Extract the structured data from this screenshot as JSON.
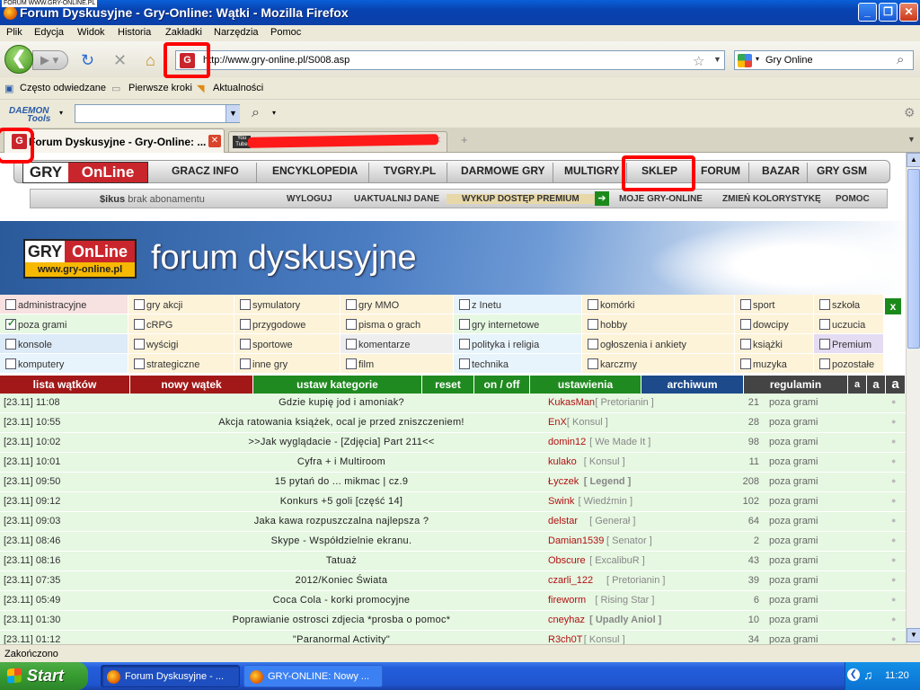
{
  "window": {
    "tiny_label": "FORUM WWW.GRY-ONLINE.PL",
    "title": "Forum Dyskusyjne - Gry-Online: Wątki - Mozilla Firefox"
  },
  "menu": [
    "Plik",
    "Edycja",
    "Widok",
    "Historia",
    "Zakładki",
    "Narzędzia",
    "Pomoc"
  ],
  "url": "http://www.gry-online.pl/S008.asp",
  "search_engine": "Gry Online",
  "bookmarks": [
    "Często odwiedzane",
    "Pierwsze kroki",
    "Aktualności"
  ],
  "daemon": {
    "line1": "DAEMON",
    "line2": "Tools"
  },
  "tabs": [
    {
      "label": "Forum Dyskusyjne - Gry-Online: ..."
    },
    {
      "label": ""
    }
  ],
  "site_nav": {
    "logo_left": "GRY",
    "logo_right": "OnLine",
    "items": [
      "GRACZ INFO",
      "ENCYKLOPEDIA",
      "TVGRY.PL",
      "DARMOWE GRY",
      "MULTIGRY",
      "SKLEP",
      "FORUM",
      "BAZAR",
      "GRY GSM"
    ]
  },
  "sub_nav": {
    "user": "$ikus",
    "user_status": "brak abonamentu",
    "items": [
      "WYLOGUJ",
      "UAKTUALNIJ DANE",
      "WYKUP DOSTĘP PREMIUM",
      "MOJE GRY-ONLINE",
      "ZMIEŃ KOLORYSTYKĘ",
      "POMOC"
    ]
  },
  "banner": {
    "logo_left": "GRY",
    "logo_right": "OnLine",
    "logo_url": "www.gry-online.pl",
    "title": "forum dyskusyjne"
  },
  "categories": [
    [
      "administracyjne",
      "gry akcji",
      "symulatory",
      "gry MMO",
      "z Inetu",
      "komórki",
      "sport",
      "szkoła"
    ],
    [
      "poza grami",
      "cRPG",
      "przygodowe",
      "pisma o grach",
      "gry internetowe",
      "hobby",
      "dowcipy",
      "uczucia"
    ],
    [
      "konsole",
      "wyścigi",
      "sportowe",
      "komentarze",
      "polityka i religia",
      "ogłoszenia i ankiety",
      "książki",
      "Premium"
    ],
    [
      "komputery",
      "strategiczne",
      "inne gry",
      "film",
      "technika",
      "karczmy",
      "muzyka",
      "pozostałe"
    ]
  ],
  "cat_close": "x",
  "actions": [
    "lista wątków",
    "nowy wątek",
    "ustaw kategorie",
    "reset",
    "on / off",
    "ustawienia",
    "archiwum",
    "regulamin",
    "a",
    "a",
    "a"
  ],
  "threads": [
    {
      "date": "[23.11] 11:08",
      "title": "Gdzie kupię jod i amoniak?",
      "user": "KukasMan",
      "rank": "[ Pretorianin ]",
      "count": "21",
      "cat": "poza grami"
    },
    {
      "date": "[23.11] 10:55",
      "title": "Akcja ratowania książek, ocal je przed zniszczeniem!",
      "user": "EnX",
      "rank": "[ Konsul ]",
      "count": "28",
      "cat": "poza grami"
    },
    {
      "date": "[23.11] 10:02",
      "title": ">>Jak wyglądacie - [Zdjęcia] Part 211<<",
      "user": "domin12",
      "rank": "[ We Made It ]",
      "count": "98",
      "cat": "poza grami"
    },
    {
      "date": "[23.11] 10:01",
      "title": "Cyfra + i Multiroom",
      "user": "kulako",
      "rank": "[ Konsul ]",
      "count": "11",
      "cat": "poza grami"
    },
    {
      "date": "[23.11] 09:50",
      "title": "15 pytań do ... mikmac | cz.9",
      "user": "Łyczek",
      "rank": "[ Legend ]",
      "count": "208",
      "cat": "poza grami"
    },
    {
      "date": "[23.11] 09:12",
      "title": "Konkurs +5 goli [część 14]",
      "user": "Swink",
      "rank": "[ Wiedźmin ]",
      "count": "102",
      "cat": "poza grami"
    },
    {
      "date": "[23.11] 09:03",
      "title": "Jaka kawa rozpuszczalna najlepsza ?",
      "user": "delstar",
      "rank": "[ Generał ]",
      "count": "64",
      "cat": "poza grami"
    },
    {
      "date": "[23.11] 08:46",
      "title": "Skype - Współdzielnie ekranu.",
      "user": "Damian1539",
      "rank": "[ Senator ]",
      "count": "2",
      "cat": "poza grami"
    },
    {
      "date": "[23.11] 08:16",
      "title": "Tatuaż",
      "user": "Obscure",
      "rank": "[ ExcalibuR ]",
      "count": "43",
      "cat": "poza grami"
    },
    {
      "date": "[23.11] 07:35",
      "title": "2012/Koniec Świata",
      "user": "czarli_122",
      "rank": "[ Pretorianin ]",
      "count": "39",
      "cat": "poza grami"
    },
    {
      "date": "[23.11] 05:49",
      "title": "Coca Cola - korki promocyjne",
      "user": "fireworm",
      "rank": "[ Rising Star ]",
      "count": "6",
      "cat": "poza grami"
    },
    {
      "date": "[23.11] 01:30",
      "title": "Poprawianie ostrosci zdjecia *prosba o pomoc*",
      "user": "cneyhaz",
      "rank": "[ Upadly Aniol ]",
      "count": "10",
      "cat": "poza grami"
    },
    {
      "date": "[23.11] 01:12",
      "title": "\"Paranormal Activity\"",
      "user": "R3ch0T",
      "rank": "[ Konsul ]",
      "count": "34",
      "cat": "poza grami"
    }
  ],
  "status": "Zakończono",
  "taskbar": {
    "start": "Start",
    "tasks": [
      "Forum Dyskusyjne - ...",
      "GRY-ONLINE: Nowy ..."
    ],
    "clock": "11:20"
  }
}
